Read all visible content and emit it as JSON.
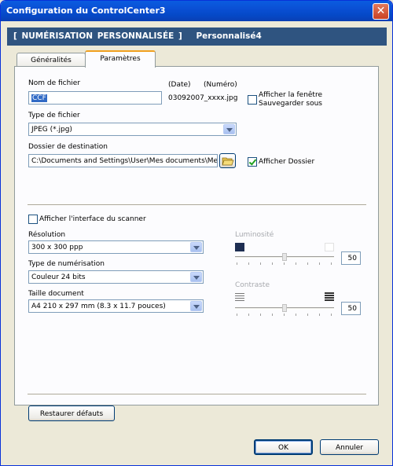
{
  "window": {
    "title": "Configuration du ControlCenter3"
  },
  "header": {
    "left": "[ NUMÉRISATION PERSONNALISÉE ]",
    "right": "Personnalisé4"
  },
  "tabs": [
    {
      "label": "Généralités",
      "active": false
    },
    {
      "label": "Paramètres",
      "active": true
    }
  ],
  "file": {
    "name_label": "Nom de fichier",
    "name_value": "CCF",
    "date_label": "(Date)",
    "number_label": "(Numéro)",
    "example": "03092007_xxxx.jpg",
    "show_saveas_label": "Afficher la fenêtre Sauvegarder sous",
    "show_saveas_checked": false,
    "type_label": "Type de fichier",
    "type_value": "JPEG (*.jpg)",
    "dest_label": "Dossier de destination",
    "dest_value": "C:\\Documents and Settings\\User\\Mes documents\\Me",
    "show_folder_label": "Afficher Dossier",
    "show_folder_checked": true
  },
  "scanner": {
    "show_interface_label": "Afficher l'interface du scanner",
    "show_interface_checked": false,
    "resolution_label": "Résolution",
    "resolution_value": "300 x 300 ppp",
    "scan_type_label": "Type de numérisation",
    "scan_type_value": "Couleur 24 bits",
    "size_label": "Taille document",
    "size_value": "A4 210 x 297 mm (8.3 x 11.7 pouces)",
    "brightness_label": "Luminosité",
    "brightness_value": "50",
    "contrast_label": "Contraste",
    "contrast_value": "50"
  },
  "buttons": {
    "restore": "Restaurer défauts",
    "ok": "OK",
    "cancel": "Annuler"
  },
  "icons": {
    "close": "close-icon",
    "browse": "folder-open-icon",
    "dropdown": "chevron-down-icon"
  },
  "colors": {
    "titlebar": "#0a4fd4",
    "header": "#2f5480",
    "selection": "#316ac5"
  }
}
